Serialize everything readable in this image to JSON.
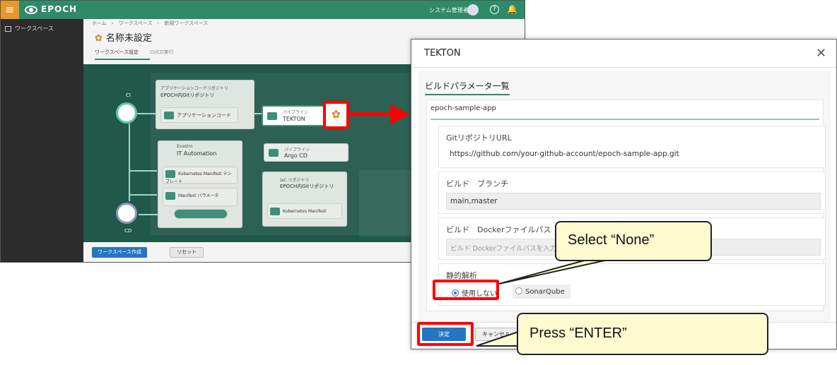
{
  "header": {
    "app_name": "EPOCH",
    "user": "システム管理者"
  },
  "sidebar": {
    "item": "ワークスペース"
  },
  "content": {
    "breadcrumb": "ホーム　›　ワークスペース　›　新規ワークスペース",
    "title": "名称未設定",
    "tabs": [
      "ワークスペース設定",
      "CI/CD実行"
    ],
    "create_button": "ワークスペース作成",
    "reset_button": "リセット"
  },
  "diagram": {
    "ci_label": "CI",
    "cd_label": "CD",
    "app_repo_caption": "アプリケーションコードリポジトリ",
    "app_repo": "EPOCH内Gitリポジトリ",
    "app_code": "アプリケーションコード",
    "pipeline_caption": "パイプライン",
    "pipeline_tekton": "TEKTON",
    "pipeline_argocd": "Argo CD",
    "exastro_caption": "Exastro",
    "exastro": "IT Automation",
    "k8s_template": "Kubernetes Manifest テンプレート",
    "manifest_params": "Manifest パラメータ",
    "iac_caption": "IaC リポジトリ",
    "iac_repo": "EPOCH内Gitリポジトリ",
    "k8s_manifest": "Kubernetes Manifest",
    "app_code_group": "アプリケーションコード"
  },
  "modal": {
    "title": "TEKTON",
    "section_tab": "ビルドパラメータ一覧",
    "app_name": "epoch-sample-app",
    "git_url_label": "GitリポジトリURL",
    "git_url_value": "https://github.com/your-github-account/epoch-sample-app.git",
    "branch_label": "ビルド　ブランチ",
    "branch_value": "main,master",
    "dockerfile_label": "ビルド　Dockerファイルパス",
    "dockerfile_placeholder": "ビルド Dockerファイルパスを入力してください",
    "static_analysis_label": "静的解析",
    "radio_none": "使用しない",
    "radio_sonar": "SonarQube",
    "ok_button": "決定",
    "cancel_button": "キャンセル"
  },
  "callouts": {
    "select_none": "Select “None”",
    "press_enter": "Press “ENTER”"
  },
  "colors": {
    "accent_green": "#2f8a67",
    "highlight_red": "#ff0000",
    "primary_blue": "#2475c2",
    "callout_yellow": "#fffbd0"
  }
}
